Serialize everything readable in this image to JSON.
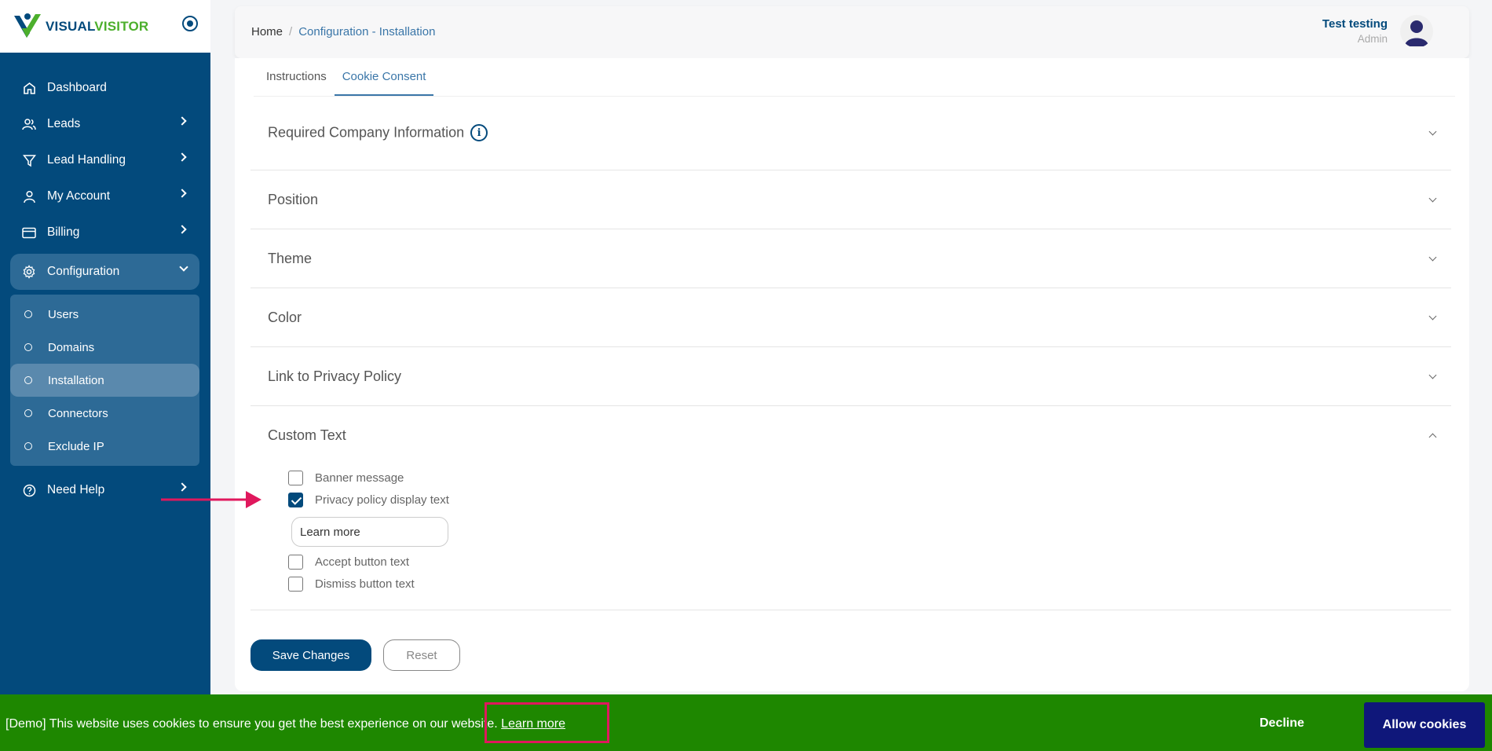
{
  "brand": {
    "part1": "VISUAL",
    "part2": "VISITOR",
    "primary_color": "#034a7c",
    "accent_color": "#4caf2c"
  },
  "sidebar": {
    "items": [
      {
        "label": "Dashboard",
        "icon": "home-icon"
      },
      {
        "label": "Leads",
        "icon": "users-icon"
      },
      {
        "label": "Lead Handling",
        "icon": "filter-icon"
      },
      {
        "label": "My Account",
        "icon": "user-icon"
      },
      {
        "label": "Billing",
        "icon": "card-icon"
      },
      {
        "label": "Configuration",
        "icon": "gear-icon"
      },
      {
        "label": "Need Help",
        "icon": "help-icon"
      }
    ],
    "config_submenu": [
      {
        "label": "Users"
      },
      {
        "label": "Domains"
      },
      {
        "label": "Installation"
      },
      {
        "label": "Connectors"
      },
      {
        "label": "Exclude IP"
      }
    ]
  },
  "header": {
    "breadcrumb": {
      "home": "Home",
      "separator": "/",
      "current": "Configuration - Installation"
    },
    "user": {
      "name": "Test testing",
      "role": "Admin"
    }
  },
  "tabs": [
    {
      "label": "Instructions"
    },
    {
      "label": "Cookie Consent"
    }
  ],
  "sections": [
    {
      "title": "Required Company Information"
    },
    {
      "title": "Position"
    },
    {
      "title": "Theme"
    },
    {
      "title": "Color"
    },
    {
      "title": "Link to Privacy Policy"
    },
    {
      "title": "Custom Text"
    }
  ],
  "custom_text": {
    "options": [
      {
        "label": "Banner message",
        "checked": false
      },
      {
        "label": "Privacy policy display text",
        "checked": true
      },
      {
        "label": "Accept button text",
        "checked": false
      },
      {
        "label": "Dismiss button text",
        "checked": false
      }
    ],
    "privacy_input_value": "Learn more"
  },
  "actions": {
    "save": "Save Changes",
    "reset": "Reset"
  },
  "banner": {
    "message": "[Demo] This website uses cookies to ensure you get the best experience on our website.",
    "link": "Learn more",
    "decline": "Decline",
    "allow": "Allow cookies",
    "bg_color": "#1e8700",
    "allow_color": "#0f177a",
    "highlight_color": "#e0185d"
  }
}
